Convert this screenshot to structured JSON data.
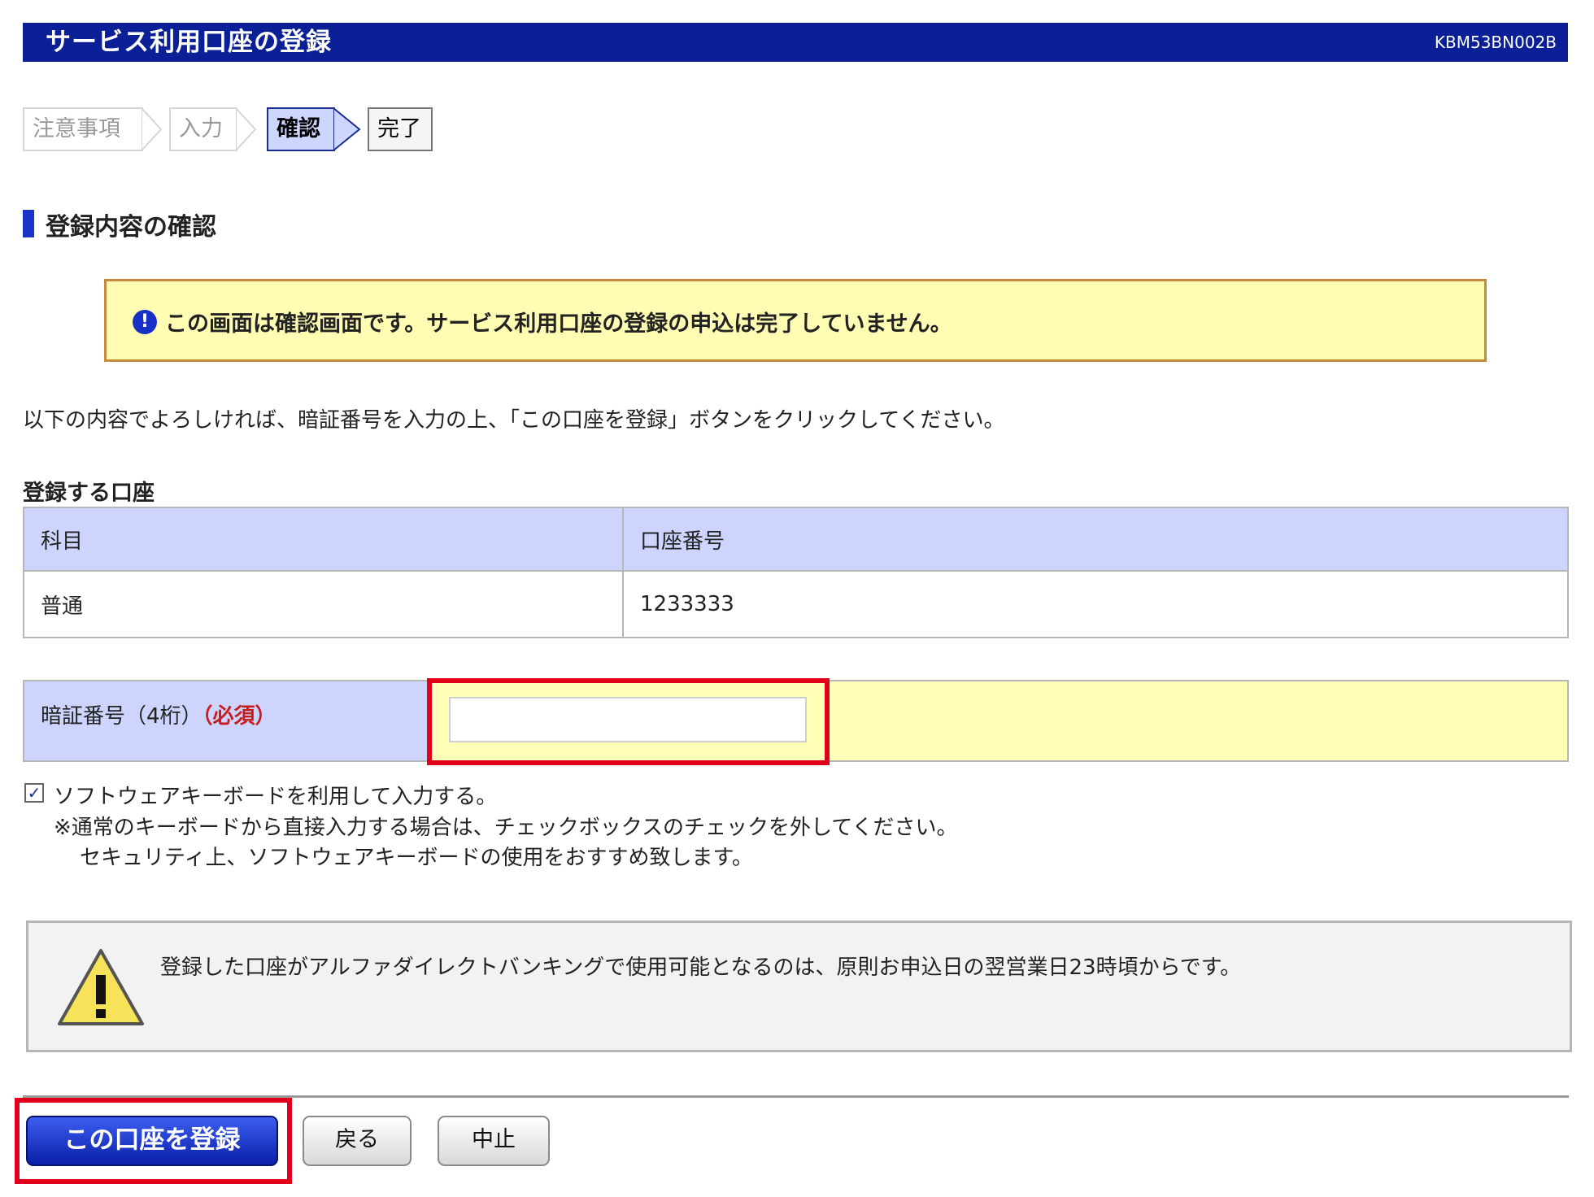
{
  "header": {
    "title": "サービス利用口座の登録",
    "code": "KBM53BN002B"
  },
  "steps": [
    {
      "label": "注意事項",
      "state": "inactive"
    },
    {
      "label": "入力",
      "state": "inactive"
    },
    {
      "label": "確認",
      "state": "active"
    },
    {
      "label": "完了",
      "state": "upcoming"
    }
  ],
  "section": {
    "title": "登録内容の確認"
  },
  "notice": {
    "icon": "info-icon",
    "text": "この画面は確認画面です。サービス利用口座の登録の申込は完了していません。"
  },
  "instruction": "以下の内容でよろしければ、暗証番号を入力の上、「この口座を登録」ボタンをクリックしてください。",
  "account_table": {
    "title": "登録する口座",
    "headers": [
      "科目",
      "口座番号"
    ],
    "rows": [
      [
        "普通",
        "1233333"
      ]
    ]
  },
  "pin": {
    "label": "暗証番号（4桁）",
    "required": "（必須）",
    "value": "",
    "placeholder": ""
  },
  "software_keyboard": {
    "checked": true,
    "label": "ソフトウェアキーボードを利用して入力する。",
    "note1": "※通常のキーボードから直接入力する場合は、チェックボックスのチェックを外してください。",
    "note2": "セキュリティ上、ソフトウェアキーボードの使用をおすすめ致します。"
  },
  "warning": {
    "icon": "warning-icon",
    "text": "登録した口座がアルファダイレクトバンキングで使用可能となるのは、原則お申込日の翌営業日23時頃からです。"
  },
  "buttons": {
    "register": "この口座を登録",
    "back": "戻る",
    "cancel": "中止"
  },
  "colors": {
    "header": "#0b1f96",
    "table_header": "#cdd5ff",
    "notice_bg": "#fffdb3",
    "highlight": "#e0001b",
    "required": "#c61e1e"
  }
}
